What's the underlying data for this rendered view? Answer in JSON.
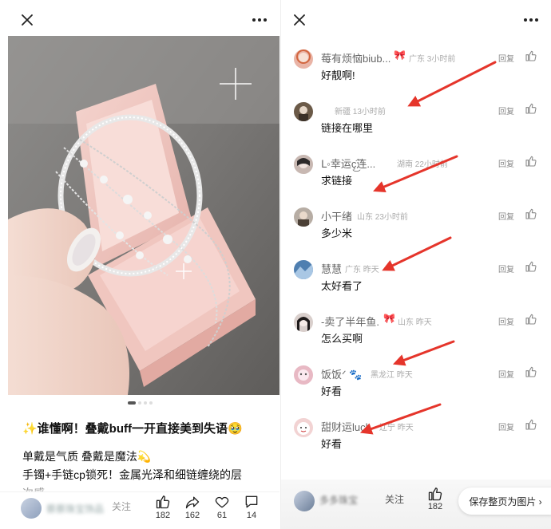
{
  "left": {
    "post": {
      "title": "✨谁懂啊！叠戴buff一开直接美到失语🥹",
      "lines": [
        "单戴是气质 叠戴是魔法💫",
        "手镯+手链cp锁死！金属光泽和细链缠绕的层",
        "次感"
      ]
    },
    "pager": {
      "count": 4,
      "active_index": 0
    },
    "bottom": {
      "author": "蔡蔡珠宝饰品",
      "follow_label": "关注",
      "actions": [
        {
          "name": "like",
          "icon": "thumbs-up-icon",
          "count": "182"
        },
        {
          "name": "share",
          "icon": "share-arrow-icon",
          "count": "162"
        },
        {
          "name": "favorite",
          "icon": "heart-icon",
          "count": "61"
        },
        {
          "name": "comment",
          "icon": "comment-bubble-icon",
          "count": "14"
        }
      ]
    }
  },
  "right": {
    "reply_label": "回复",
    "comments": [
      {
        "name": "莓有烦恼biub...",
        "badge": "🎀",
        "meta": "广东 3小时前",
        "text": "好靓啊!",
        "avatar_color": "#e9b4a6"
      },
      {
        "name": "",
        "badge": "",
        "meta": "新疆 13小时前",
        "text": "链接在哪里",
        "avatar_color": "#6b5a48"
      },
      {
        "name": "ᒪ◦幸运ç͜͡连...",
        "badge": "",
        "meta": "湖南 22小时前",
        "text": "求链接",
        "avatar_color": "#c8b8b2"
      },
      {
        "name": "小干绪",
        "badge": "",
        "meta": "山东 23小时前",
        "text": "多少米",
        "avatar_color": "#b7ada4"
      },
      {
        "name": "慧慧",
        "badge": "",
        "meta": "广东 昨天",
        "text": "太好看了",
        "avatar_color": "#4f7fb0"
      },
      {
        "name": "-卖了半年鱼.",
        "badge": "🎀",
        "meta": "山东 昨天",
        "text": "怎么买啊",
        "avatar_color": "#d9cfcc"
      },
      {
        "name": "饭饭ᐟ 🐾",
        "badge": "",
        "meta": "黑龙江 昨天",
        "text": "好看",
        "avatar_color": "#e8b9c4"
      },
      {
        "name": "甜财运luck",
        "badge": "",
        "meta": "辽宁 昨天",
        "text": "好看",
        "avatar_color": "#f2d3d3"
      }
    ],
    "bottom": {
      "author": "多多珠宝",
      "follow_label": "关注",
      "like_count": "182",
      "save_label": "保存整页为图片 ›"
    }
  },
  "colors": {
    "accent": "#e5352b",
    "pink_box": "#f3c8c4"
  }
}
